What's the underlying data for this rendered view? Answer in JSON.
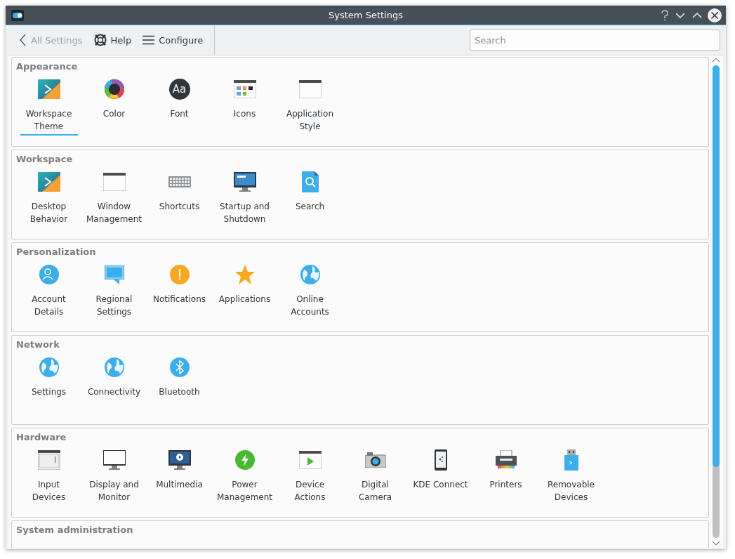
{
  "window": {
    "title": "System Settings"
  },
  "toolbar": {
    "back": {
      "label": "All Settings",
      "disabled": true
    },
    "help": {
      "label": "Help"
    },
    "configure": {
      "label": "Configure"
    },
    "search": {
      "placeholder": "Search"
    }
  },
  "sections": [
    {
      "title": "Appearance",
      "items": [
        {
          "label": "Workspace Theme",
          "selected": true
        },
        {
          "label": "Color",
          "selected": false
        },
        {
          "label": "Font",
          "selected": false,
          "icon_text": "Aa"
        },
        {
          "label": "Icons",
          "selected": false
        },
        {
          "label": "Application Style",
          "selected": false
        }
      ]
    },
    {
      "title": "Workspace",
      "items": [
        {
          "label": "Desktop Behavior",
          "selected": false
        },
        {
          "label": "Window Management",
          "selected": false
        },
        {
          "label": "Shortcuts",
          "selected": false
        },
        {
          "label": "Startup and Shutdown",
          "selected": false
        },
        {
          "label": "Search",
          "selected": false
        }
      ]
    },
    {
      "title": "Personalization",
      "items": [
        {
          "label": "Account Details",
          "selected": false
        },
        {
          "label": "Regional Settings",
          "selected": false
        },
        {
          "label": "Notifications",
          "selected": false
        },
        {
          "label": "Applications",
          "selected": false
        },
        {
          "label": "Online Accounts",
          "selected": false
        }
      ]
    },
    {
      "title": "Network",
      "items": [
        {
          "label": "Settings",
          "selected": false
        },
        {
          "label": "Connectivity",
          "selected": false
        },
        {
          "label": "Bluetooth",
          "selected": false
        }
      ]
    },
    {
      "title": "Hardware",
      "items": [
        {
          "label": "Input Devices",
          "selected": false
        },
        {
          "label": "Display and Monitor",
          "selected": false
        },
        {
          "label": "Multimedia",
          "selected": false
        },
        {
          "label": "Power Management",
          "selected": false
        },
        {
          "label": "Device Actions",
          "selected": false
        },
        {
          "label": "Digital Camera",
          "selected": false
        },
        {
          "label": "KDE Connect",
          "selected": false
        },
        {
          "label": "Printers",
          "selected": false
        },
        {
          "label": "Removable Devices",
          "selected": false
        }
      ]
    },
    {
      "title": "System administration"
    }
  ]
}
